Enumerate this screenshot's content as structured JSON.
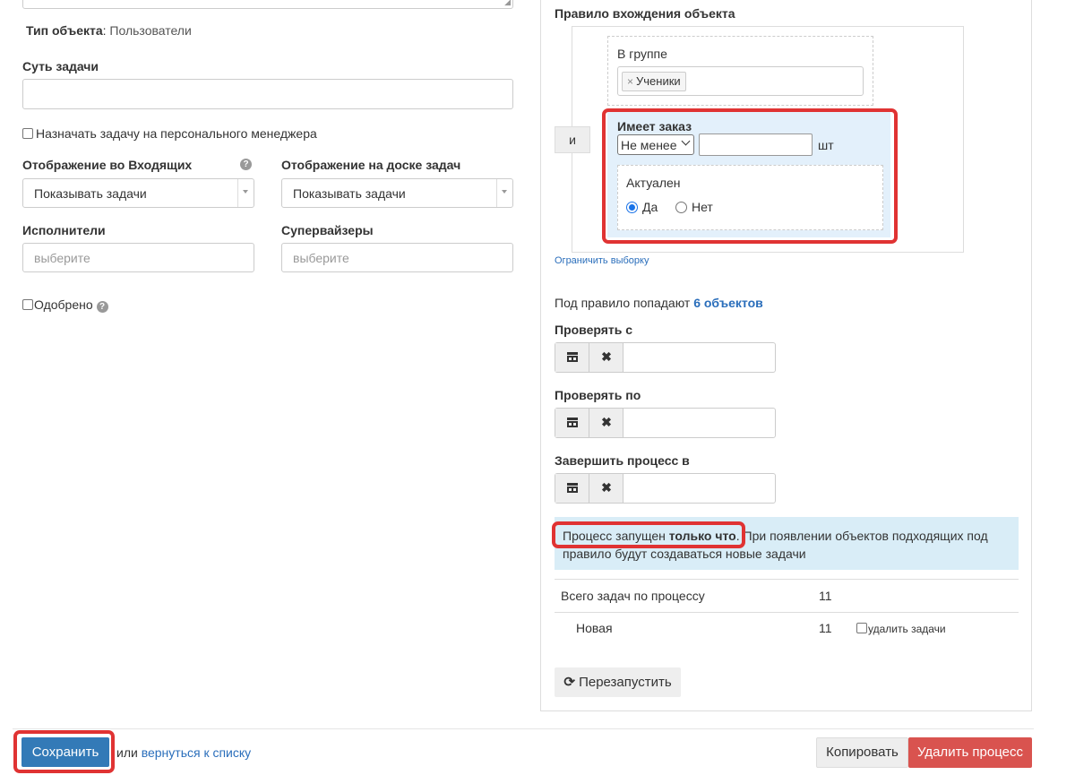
{
  "left": {
    "object_type": {
      "label": "Тип объекта",
      "value": "Пользователи"
    },
    "task_essence": {
      "label": "Суть задачи",
      "value": ""
    },
    "assign_personal_manager": {
      "label": "Назначать задачу на персонального менеджера",
      "checked": false
    },
    "inbox_display": {
      "label": "Отображение во Входящих",
      "value": "Показывать задачи"
    },
    "board_display": {
      "label": "Отображение на доске задач",
      "value": "Показывать задачи"
    },
    "executors": {
      "label": "Исполнители",
      "placeholder": "выберите"
    },
    "supervisors": {
      "label": "Супервайзеры",
      "placeholder": "выберите"
    },
    "approved": {
      "label": "Одобрено",
      "checked": false
    }
  },
  "rule": {
    "title": "Правило вхождения объекта",
    "and_button": "и",
    "in_group": {
      "label": "В группе",
      "tag": "Ученики",
      "tag_remove": "×"
    },
    "has_order": {
      "label": "Имеет заказ",
      "operator": "Не менее",
      "quantity": "",
      "unit": "шт",
      "actual": {
        "label": "Актуален",
        "options": [
          "Да",
          "Нет"
        ],
        "selected": "Да"
      }
    },
    "limit_link": "Ограничить выборку",
    "matches_prefix": "Под правило попадают",
    "matches_count": "6 объектов"
  },
  "dates": {
    "check_from": {
      "label": "Проверять с",
      "value": ""
    },
    "check_to": {
      "label": "Проверять по",
      "value": ""
    },
    "finish_at": {
      "label": "Завершить процесс в",
      "value": ""
    },
    "clear_symbol": "✖"
  },
  "status": {
    "prefix": "Процесс запущен ",
    "emph": "только что",
    "rest_line1": ". При появлении объектов подходящих под",
    "line2": "правило будут создаваться новые задачи"
  },
  "stats": {
    "total_label": "Всего задач по процессу",
    "total_value": "11",
    "rows": [
      {
        "label": "Новая",
        "value": "11",
        "delete_label": "удалить задачи",
        "delete_checked": false
      }
    ]
  },
  "buttons": {
    "restart": "Перезапустить",
    "save": "Сохранить",
    "or_text": "или",
    "back_link": "вернуться к списку",
    "copy": "Копировать",
    "delete_process": "Удалить процесс"
  },
  "colors": {
    "primary": "#337ab7",
    "danger": "#d9534f",
    "highlight_frame": "#e03333",
    "info_bg": "#d9edf7",
    "selected_block_bg": "#e3f0fb",
    "link": "#2a6ebb"
  }
}
